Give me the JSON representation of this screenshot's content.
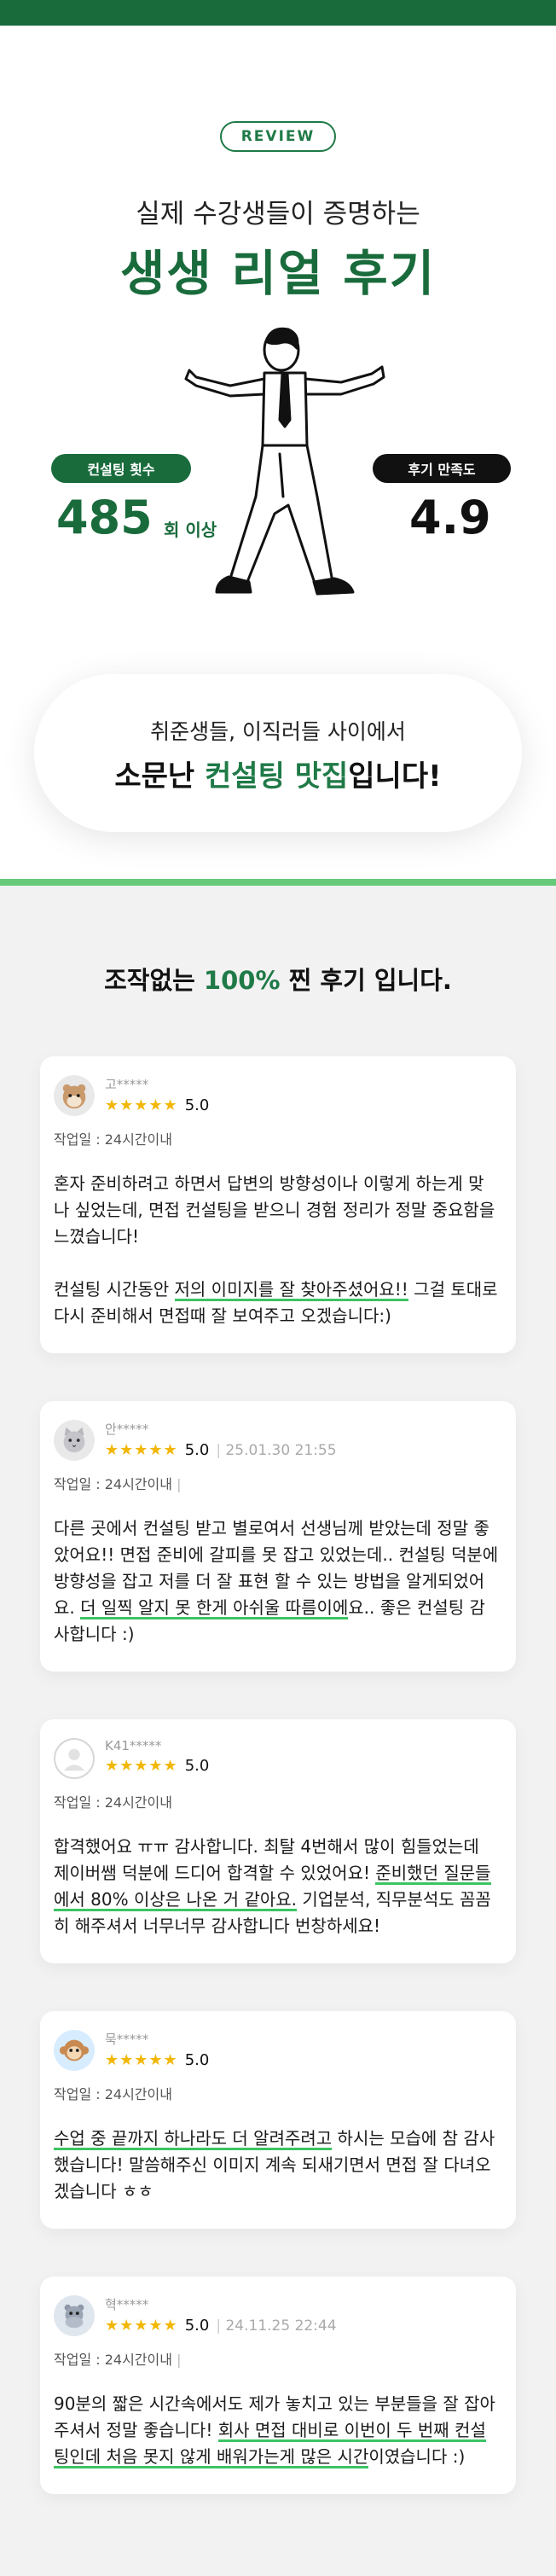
{
  "hero": {
    "review_pill": "REVIEW",
    "subtitle": "실제 수강생들이 증명하는",
    "title": "생생 리얼 후기",
    "stat_left_badge": "컨설팅 횟수",
    "stat_left_value": "485",
    "stat_left_unit": "회 이상",
    "stat_right_badge": "후기 만족도",
    "stat_right_value": "4.9"
  },
  "bubble": {
    "line1": "취준생들, 이직러들 사이에서",
    "line2_pre": "소문난 ",
    "line2_highlight": "컨설팅 맛집",
    "line2_post": "입니다!"
  },
  "section": {
    "title_pre": "조작없는 ",
    "title_pct": "100%",
    "title_post": " 찐 후기 입니다."
  },
  "reviews": [
    {
      "name": "고*****",
      "stars": "★★★★★",
      "rating": "5.0",
      "date": "",
      "written": "작업일 : 24시간이내",
      "p1": "혼자 준비하려고 하면서 답변의 방향성이나 이렇게 하는게 맞나 싶었는데, 면접 컨설팅을 받으니 경험 정리가 정말 중요함을 느꼈습니다!",
      "p2_pre": "컨설팅 시간동안 ",
      "p2_ul": "저의 이미지를 잘 찾아주셨어요!!",
      "p2_post": " 그걸 토대로 다시 준비해서 면접때 잘 보여주고 오겠습니다:)",
      "avatar_icon": "hamster-icon"
    },
    {
      "name": "안*****",
      "stars": "★★★★★",
      "rating": "5.0",
      "date": "25.01.30 21:55",
      "written": "작업일 : 24시간이내",
      "written_sep": "|",
      "p1_pre": "다른 곳에서 컨설팅 받고 별로여서 선생님께 받았는데 정말 좋았어요!! 면접 준비에 갈피를 못 잡고 있었는데.. 컨설팅 덕분에 방향성을 잡고 저를 더 잘 표현 할 수 있는 방법을 알게되었어요. ",
      "p1_ul": "더 일찍 알지 못 한게 아쉬울 따름이에",
      "p1_post": "요.. 좋은 컨설팅 감사합니다 :)",
      "avatar_icon": "cat-icon"
    },
    {
      "name": "K41*****",
      "stars": "★★★★★",
      "rating": "5.0",
      "date": "",
      "written": "작업일 : 24시간이내",
      "p1_pre": "합격했어요 ㅠㅠ 감사합니다. 최탈 4번해서 많이 힘들었는데 제이버쌤 덕분에 드디어 합격할 수 있었어요! ",
      "p1_ul": "준비했던 질문들에서 80% 이상은 나온 거 같아요.",
      "p1_post": " 기업분석, 직무분석도 꼼꼼히 해주셔서 너무너무 감사합니다 번창하세요!",
      "avatar_icon": "default-user-icon"
    },
    {
      "name": "묵*****",
      "stars": "★★★★★",
      "rating": "5.0",
      "date": "",
      "written": "작업일 : 24시간이내",
      "p1_ul": "수업 중 끝까지 하나라도 더 알려주려고",
      "p1_post": " 하시는 모습에 참 감사했습니다! 말씀해주신 이미지 계속 되새기면서 면접 잘 다녀오겠습니다 ㅎㅎ",
      "avatar_icon": "monkey-icon"
    },
    {
      "name": "혁*****",
      "stars": "★★★★★",
      "rating": "5.0",
      "date": "24.11.25 22:44",
      "written": "작업일 : 24시간이내",
      "written_sep": "|",
      "p1_pre": "90분의 짧은 시간속에서도 제가 놓치고 있는 부분들을 잘 잡아주셔서 정말 좋습니다! ",
      "p1_ul": "회사 면접 대비로 이번이 두 번째 컨설팅인데 처음 못지 않게 배워가는게 많은 시간",
      "p1_post": "이였습니다 :)",
      "avatar_icon": "hippo-icon"
    }
  ],
  "colors": {
    "brand_green": "#196b3c",
    "accent_green": "#1f7a47",
    "underline_green": "#3cc463",
    "star_yellow": "#f2b705"
  }
}
